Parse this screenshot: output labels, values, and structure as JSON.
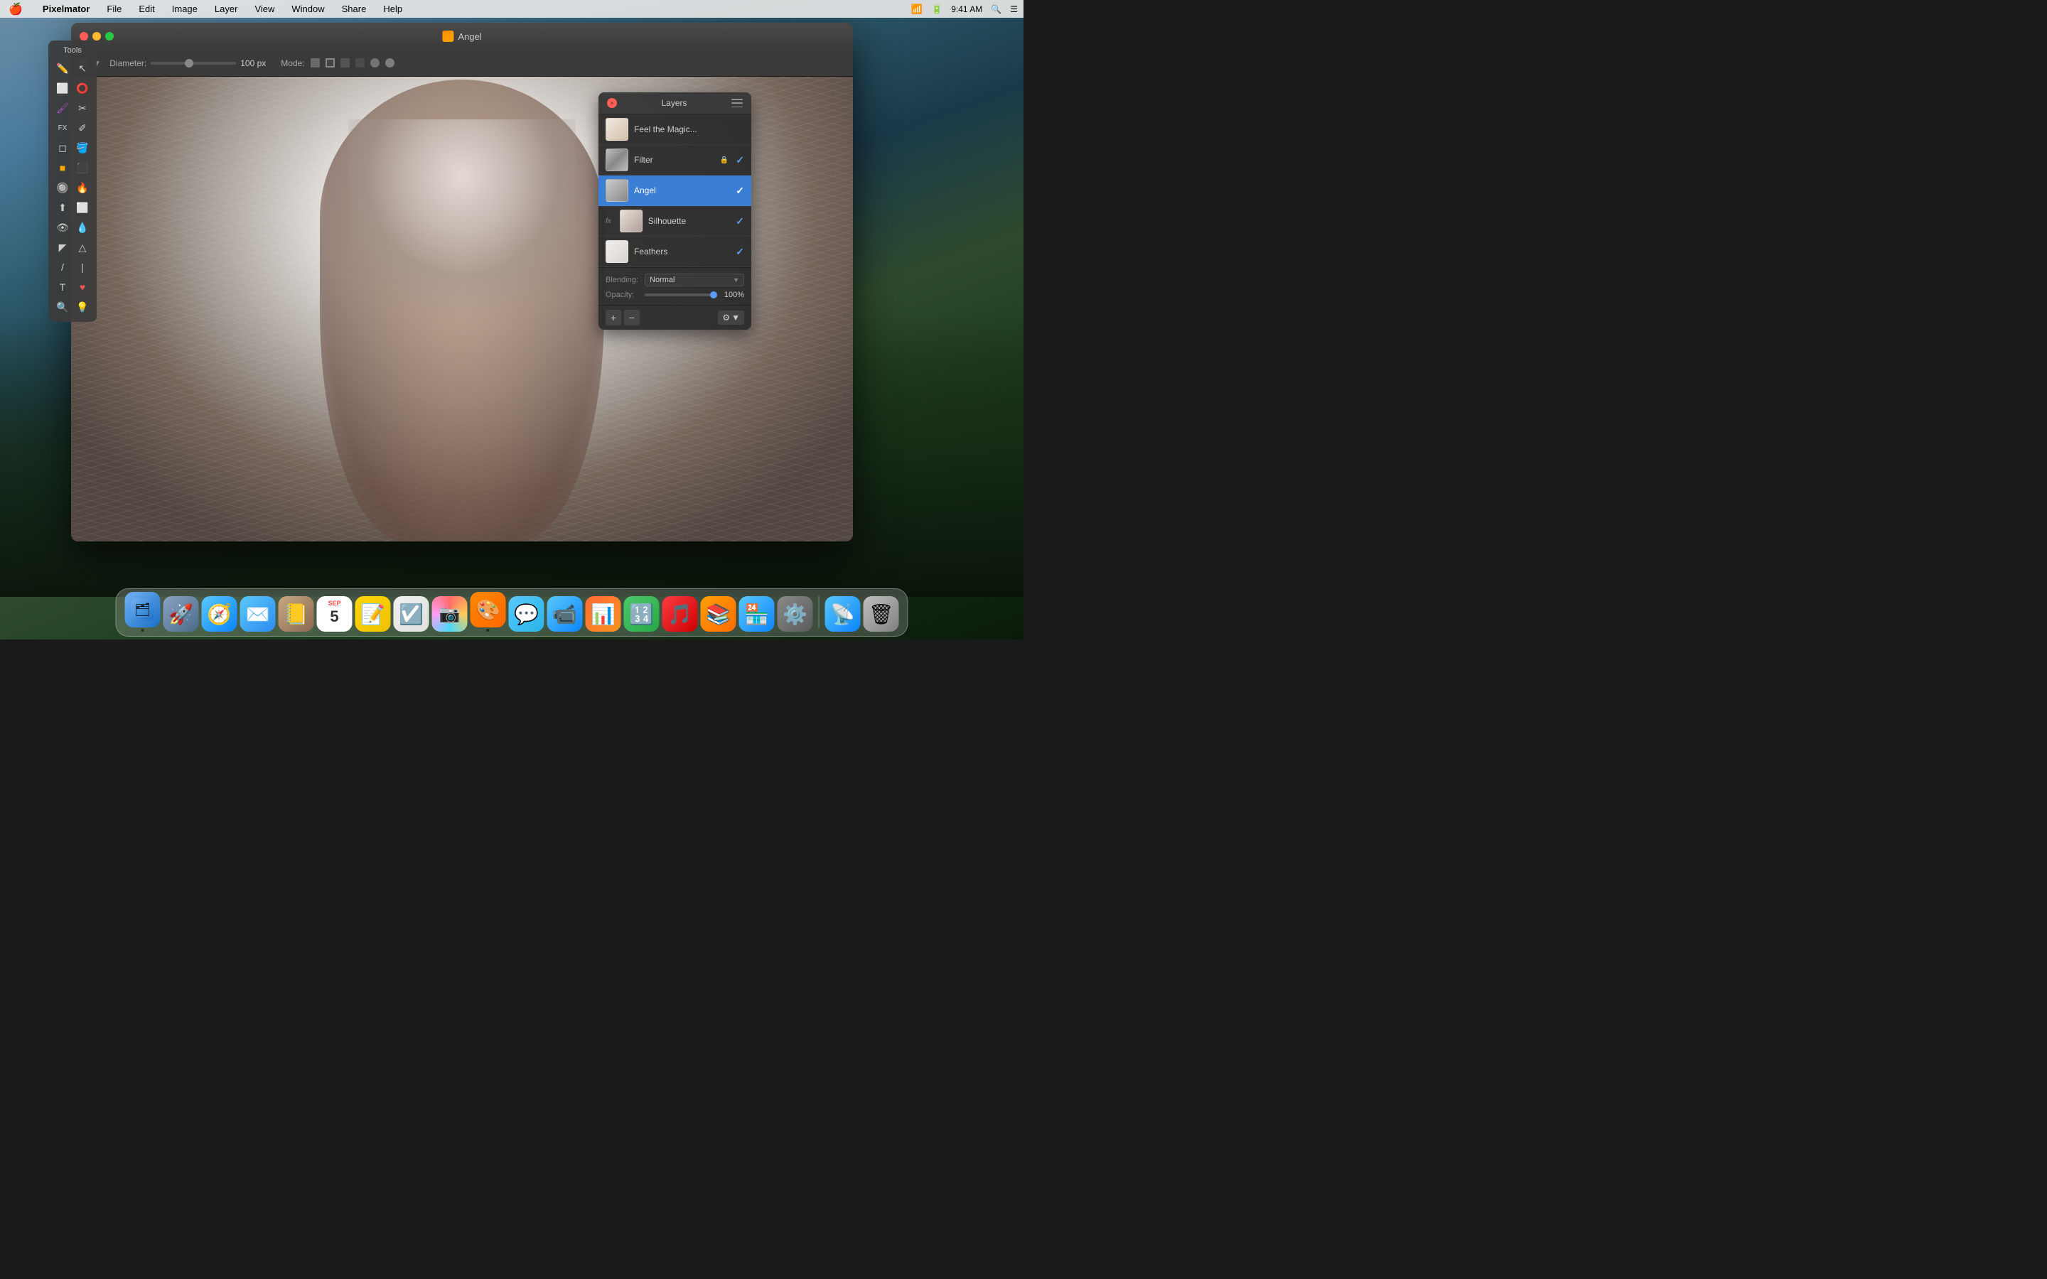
{
  "menubar": {
    "apple": "🍎",
    "app_name": "Pixelmator",
    "menus": [
      "File",
      "Edit",
      "Image",
      "Layer",
      "View",
      "Window",
      "Share",
      "Help"
    ],
    "time": "9:41 AM",
    "wifi_icon": "wifi",
    "battery_icon": "battery"
  },
  "tools_panel": {
    "title": "Tools"
  },
  "app_window": {
    "title": "Angel",
    "icon": "🎨"
  },
  "toolbar": {
    "diameter_label": "Diameter:",
    "diameter_value": "100 px",
    "mode_label": "Mode:"
  },
  "layers_panel": {
    "title": "Layers",
    "layers": [
      {
        "id": "feel",
        "name": "Feel the Magic...",
        "thumbnail_class": "feel",
        "active": false,
        "checked": false,
        "locked": false,
        "has_fx": false
      },
      {
        "id": "filter",
        "name": "Filter",
        "thumbnail_class": "filter",
        "active": false,
        "checked": true,
        "locked": true,
        "has_fx": false
      },
      {
        "id": "angel",
        "name": "Angel",
        "thumbnail_class": "angel",
        "active": true,
        "checked": true,
        "locked": false,
        "has_fx": false
      },
      {
        "id": "silhouette",
        "name": "Silhouette",
        "thumbnail_class": "silhouette",
        "active": false,
        "checked": true,
        "locked": false,
        "has_fx": true
      },
      {
        "id": "feathers",
        "name": "Feathers",
        "thumbnail_class": "feathers",
        "active": false,
        "checked": true,
        "locked": false,
        "has_fx": false
      }
    ],
    "blending_label": "Blending:",
    "blending_value": "Normal",
    "opacity_label": "Opacity:",
    "opacity_value": "100%",
    "add_label": "+",
    "remove_label": "−",
    "gear_label": "⚙"
  },
  "dock": {
    "items": [
      {
        "name": "Finder",
        "icon_class": "finder-icon",
        "emoji": "🗂",
        "has_dot": true
      },
      {
        "name": "Launchpad",
        "icon_class": "launchpad-icon",
        "emoji": "🚀",
        "has_dot": false
      },
      {
        "name": "Safari",
        "icon_class": "safari-icon",
        "emoji": "🧭",
        "has_dot": false
      },
      {
        "name": "Mail",
        "icon_class": "mail-icon",
        "emoji": "✉️",
        "has_dot": false
      },
      {
        "name": "Contacts",
        "icon_class": "contacts-icon",
        "emoji": "📒",
        "has_dot": false
      },
      {
        "name": "Calendar",
        "icon_class": "calendar-icon",
        "emoji": "📅",
        "has_dot": false,
        "date": "5",
        "month": "SEP"
      },
      {
        "name": "Notes",
        "icon_class": "notes-icon",
        "emoji": "📝",
        "has_dot": false
      },
      {
        "name": "Reminders",
        "icon_class": "reminders-icon",
        "emoji": "☑️",
        "has_dot": false
      },
      {
        "name": "Photos",
        "icon_class": "photos-icon",
        "emoji": "🖼",
        "has_dot": false
      },
      {
        "name": "Pixelmator",
        "icon_class": "pixelmator-icon",
        "emoji": "🎨",
        "has_dot": true
      },
      {
        "name": "Messages",
        "icon_class": "messages-icon",
        "emoji": "💬",
        "has_dot": false
      },
      {
        "name": "FaceTime",
        "icon_class": "facetime-icon",
        "emoji": "📹",
        "has_dot": false
      },
      {
        "name": "Presentation",
        "icon_class": "presentation-icon",
        "emoji": "📊",
        "has_dot": false
      },
      {
        "name": "Numbers",
        "icon_class": "numbers-icon",
        "emoji": "🔢",
        "has_dot": false
      },
      {
        "name": "iTunes",
        "icon_class": "itunes-icon",
        "emoji": "🎵",
        "has_dot": false
      },
      {
        "name": "Books",
        "icon_class": "books-icon",
        "emoji": "📚",
        "has_dot": false
      },
      {
        "name": "AppStore",
        "icon_class": "appstore-icon",
        "emoji": "🏪",
        "has_dot": false
      },
      {
        "name": "System Preferences",
        "icon_class": "syspref-icon",
        "emoji": "⚙️",
        "has_dot": false
      },
      {
        "name": "AirDrop",
        "icon_class": "airdrop-icon",
        "emoji": "📡",
        "has_dot": false
      },
      {
        "name": "Trash",
        "icon_class": "trash-icon",
        "emoji": "🗑",
        "has_dot": false
      }
    ]
  }
}
